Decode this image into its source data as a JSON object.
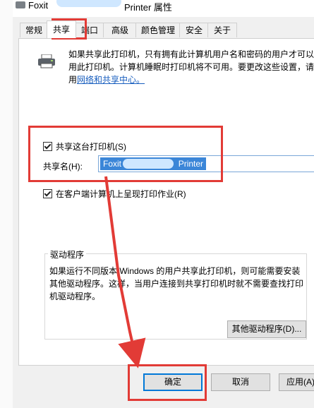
{
  "dialog": {
    "title_left": "Foxit",
    "title_right": "Printer 属性"
  },
  "tabs": [
    {
      "label": "常规"
    },
    {
      "label": "共享"
    },
    {
      "label": "端口"
    },
    {
      "label": "高级"
    },
    {
      "label": "颜色管理"
    },
    {
      "label": "安全"
    },
    {
      "label": "关于"
    }
  ],
  "sharing": {
    "intro_text": "如果共享此打印机，只有拥有此计算机用户名和密码的用户才可以使用此打印机。计算机睡眠时打印机将不可用。要更改这些设置，请使用",
    "intro_link": "网络和共享中心。",
    "share_checkbox_label": "共享这台打印机(S)",
    "share_checked": true,
    "share_name_label": "共享名(H):",
    "share_name_value_left": "Foxit",
    "share_name_value_right": "Printer",
    "render_checkbox_label": "在客户端计算机上呈现打印作业(R)",
    "render_checked": true
  },
  "drivers": {
    "title": "驱动程序",
    "description": "如果运行不同版本 Windows 的用户共享此打印机，则可能需要安装其他驱动程序。这样，当用户连接到共享打印机时就不需要查找打印机驱动程序。",
    "other_drivers_button": "其他驱动程序(D)..."
  },
  "buttons": {
    "ok": "确定",
    "cancel": "取消",
    "apply": "应用(A)"
  },
  "colors": {
    "highlight": "#e23b36",
    "selection": "#3b86d8",
    "link": "#1a5fbf"
  }
}
